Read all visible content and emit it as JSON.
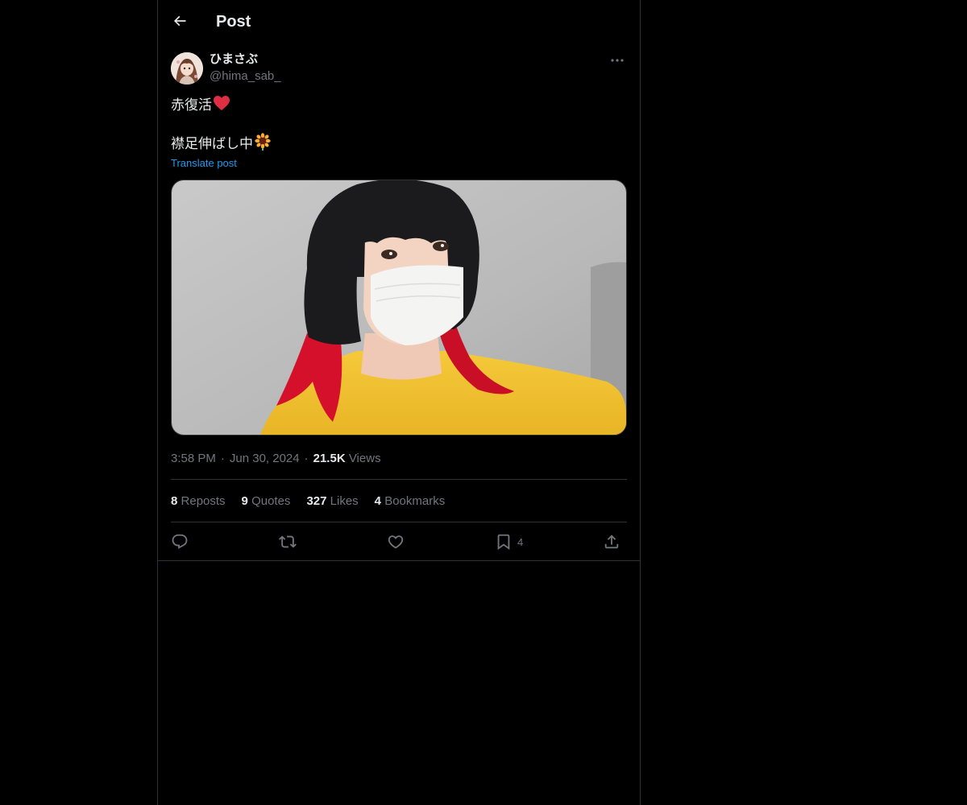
{
  "header": {
    "title": "Post",
    "back_icon": "arrow-left-icon"
  },
  "author": {
    "display_name": "ひまさぶ",
    "handle": "@hima_sab_",
    "more_icon": "more-dots-icon"
  },
  "post": {
    "line1": "赤復活",
    "line1_emoji": "❤️",
    "line2": "襟足伸ばし中",
    "line2_emoji": "🌻",
    "translate_label": "Translate post"
  },
  "meta": {
    "time": "3:58 PM",
    "date": "Jun 30, 2024",
    "views_count": "21.5K",
    "views_label": "Views"
  },
  "stats": {
    "reposts_count": "8",
    "reposts_label": "Reposts",
    "quotes_count": "9",
    "quotes_label": "Quotes",
    "likes_count": "327",
    "likes_label": "Likes",
    "bookmarks_count": "4",
    "bookmarks_label": "Bookmarks"
  },
  "actions": {
    "reply_icon": "reply-icon",
    "repost_icon": "repost-icon",
    "like_icon": "heart-icon",
    "bookmark_icon": "bookmark-icon",
    "bookmark_count": "4",
    "share_icon": "share-icon"
  },
  "colors": {
    "background": "#000000",
    "text": "#e7e9ea",
    "secondary": "#71767b",
    "link": "#1d9bf0",
    "border": "#2f3336"
  }
}
